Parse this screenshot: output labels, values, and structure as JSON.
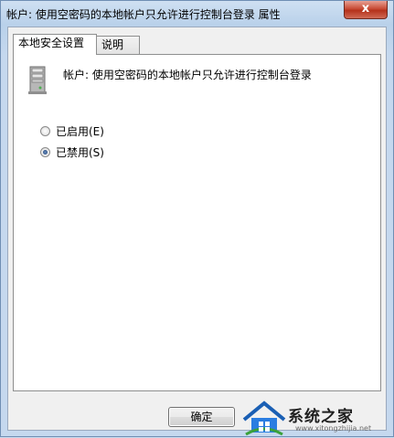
{
  "window": {
    "title": "帐户: 使用空密码的本地帐户只允许进行控制台登录 属性",
    "close_glyph": "x"
  },
  "tabs": [
    {
      "label": "本地安全设置",
      "active": true
    },
    {
      "label": "说明",
      "active": false
    }
  ],
  "policy": {
    "name": "帐户: 使用空密码的本地帐户只允许进行控制台登录",
    "icon": "server-icon"
  },
  "options": [
    {
      "label": "已启用(E)",
      "checked": false
    },
    {
      "label": "已禁用(S)",
      "checked": true
    }
  ],
  "buttons": {
    "ok_label": "确定"
  },
  "watermark": {
    "text": "系统之家",
    "url": "www.xitongzhijia.net"
  },
  "colors": {
    "accent": "#1d3f74",
    "close": "#c84c36"
  }
}
